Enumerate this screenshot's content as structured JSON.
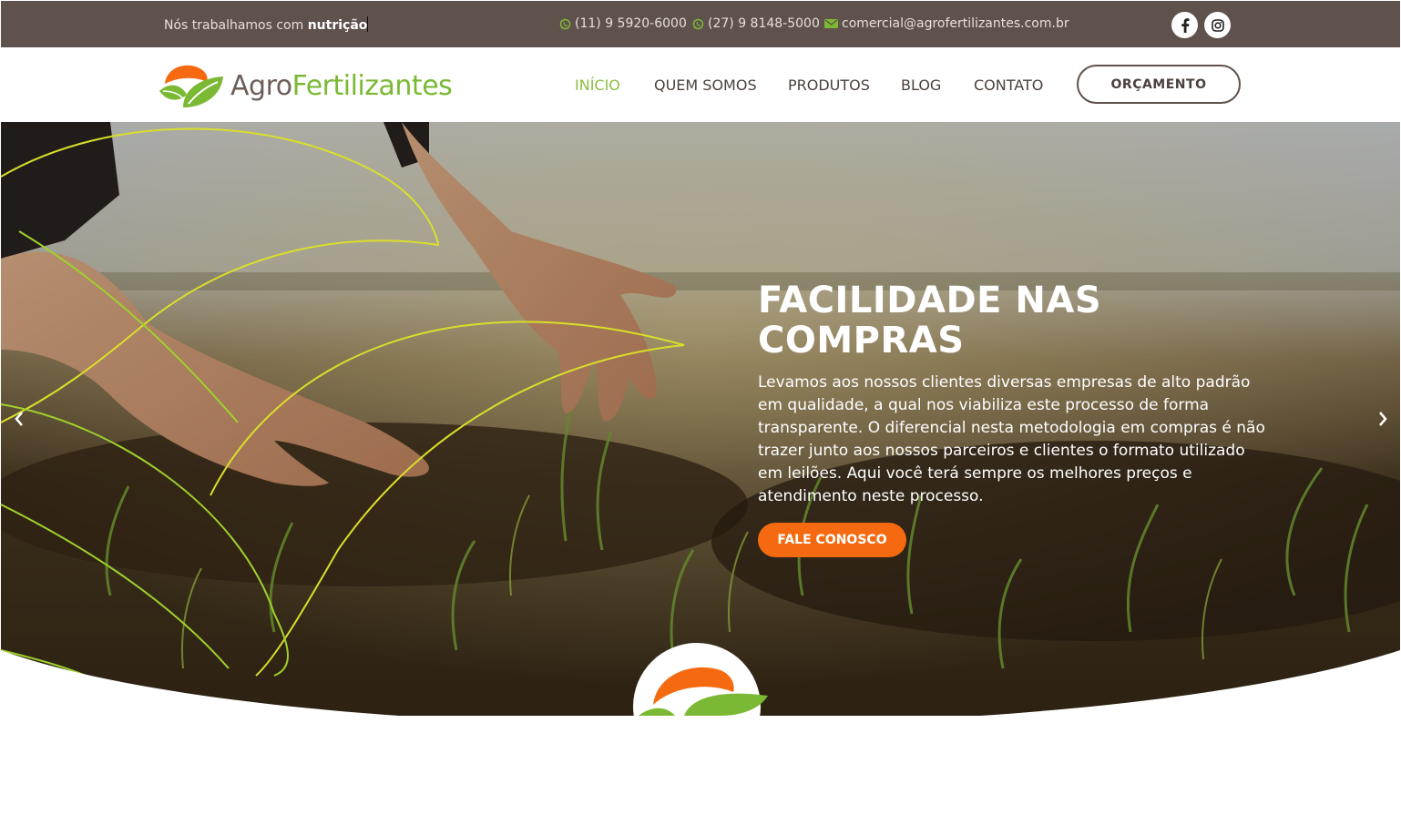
{
  "topbar": {
    "tagline_prefix": "Nós trabalhamos com ",
    "tagline_word": "nutrição",
    "phone1": "(11) 9 5920-6000",
    "phone2": "(27) 9 8148-5000",
    "email": "comercial@agrofertilizantes.com.br",
    "social_icons": [
      "facebook-icon",
      "instagram-icon"
    ],
    "icons": {
      "phone": "whatsapp-icon",
      "email": "envelope-icon"
    }
  },
  "header": {
    "logo_part1": "Agro",
    "logo_part2": "Fertilizantes",
    "nav": [
      "INÍCIO",
      "QUEM SOMOS",
      "PRODUTOS",
      "BLOG",
      "CONTATO"
    ],
    "active_nav": "INÍCIO",
    "cta": "ORÇAMENTO"
  },
  "hero": {
    "title_line1": "FACILIDADE NAS",
    "title_line2": "COMPRAS",
    "text": "Levamos aos nossos clientes diversas empresas de alto padrão em qualidade, a qual nos viabiliza este processo de forma transparente. O diferencial nesta metodologia em compras é não trazer junto aos nossos parceiros e clientes o formato utilizado em leilões. Aqui você terá sempre os melhores preços e atendimento neste processo.",
    "button": "FALE CONOSCO",
    "prev_icon": "chevron-left-icon",
    "next_icon": "chevron-right-icon"
  },
  "colors": {
    "topbar_bg": "#5f514c",
    "brand_green": "#7bb935",
    "brand_orange": "#f56a10",
    "text_brown": "#4b403c"
  }
}
